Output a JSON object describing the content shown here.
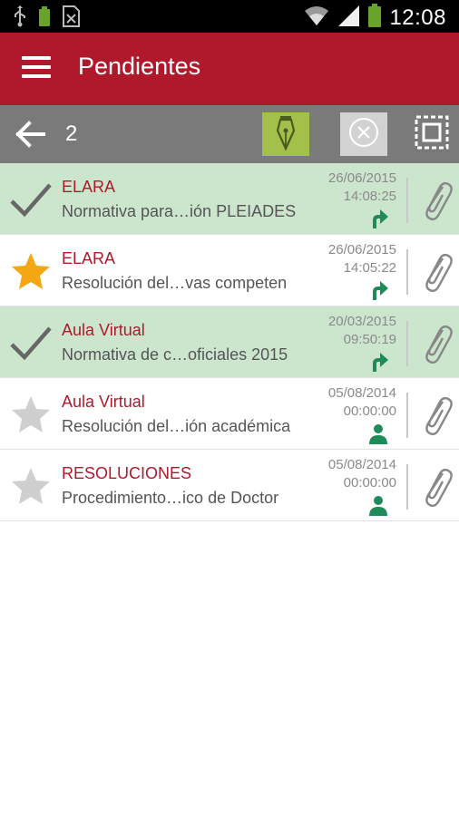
{
  "status_bar": {
    "time": "12:08",
    "icons": [
      "usb-icon",
      "battery-small-icon",
      "sim-blocked-icon",
      "wifi-icon",
      "signal-icon",
      "battery-icon"
    ]
  },
  "app_bar": {
    "title": "Pendientes",
    "menu_icon": "hamburger-menu-icon"
  },
  "action_bar": {
    "selected_count": "2",
    "back_icon": "back-arrow-icon",
    "actions": [
      "sign-pen-icon",
      "reject-circle-x-icon",
      "select-all-icon"
    ]
  },
  "colors": {
    "brand_red": "#b0192b",
    "action_gray": "#7a7a7a",
    "selected_row": "#cce6cd",
    "sign_green": "#a3c14a",
    "star_gold": "#f3a712",
    "type_teal": "#1e8c5a"
  },
  "items": [
    {
      "sender": "ELARA",
      "subject": "Normativa para…ión PLEIADES",
      "date": "26/06/2015",
      "time": "14:08:25",
      "state": "checked",
      "selected": true,
      "type_icon": "forward-arrow-icon"
    },
    {
      "sender": "ELARA",
      "subject": "Resolución del…vas competen",
      "date": "26/06/2015",
      "time": "14:05:22",
      "state": "starred",
      "selected": false,
      "type_icon": "forward-arrow-icon"
    },
    {
      "sender": "Aula Virtual",
      "subject": "Normativa de c…oficiales 2015",
      "date": "20/03/2015",
      "time": "09:50:19",
      "state": "checked",
      "selected": true,
      "type_icon": "forward-arrow-icon"
    },
    {
      "sender": "Aula Virtual",
      "subject": "Resolución del…ión académica",
      "date": "05/08/2014",
      "time": "00:00:00",
      "state": "unstarred",
      "selected": false,
      "type_icon": "person-icon"
    },
    {
      "sender": "RESOLUCIONES",
      "subject": "Procedimiento…ico de Doctor",
      "date": "05/08/2014",
      "time": "00:00:00",
      "state": "unstarred",
      "selected": false,
      "type_icon": "person-icon"
    }
  ]
}
